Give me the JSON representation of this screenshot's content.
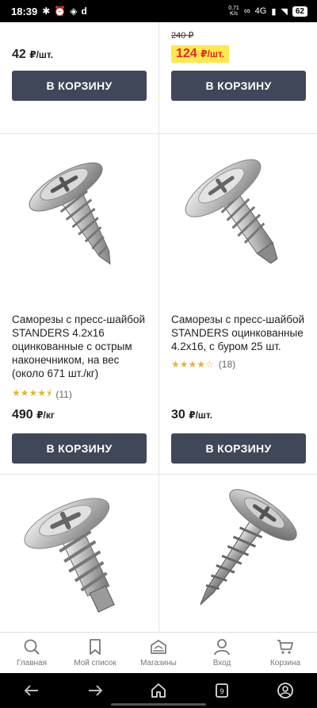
{
  "status_bar": {
    "time": "18:39",
    "net_speed": "0,71",
    "net_unit": "K/s",
    "signal": "4G",
    "battery": "62"
  },
  "products": [
    {
      "price_value": "42",
      "price_unit": "₽/шт.",
      "button_label": "В КОРЗИНУ"
    },
    {
      "old_price": "240 ₽",
      "price_value": "124",
      "price_unit": "₽/шт.",
      "button_label": "В КОРЗИНУ"
    },
    {
      "title": "Саморезы с пресс-шайбой STANDERS 4.2x16 оцинкованные с острым наконечником, на вес (около 671 шт./кг)",
      "rating_stars": 4.5,
      "reviews": "(11)",
      "price_value": "490",
      "price_unit": "₽/кг",
      "button_label": "В КОРЗИНУ",
      "image_icon": "screw-sharp-tip-icon"
    },
    {
      "title": "Саморезы с пресс-шайбой STANDERS оцинкованные 4.2x16, с буром 25 шт.",
      "rating_stars": 4,
      "reviews": "(18)",
      "price_value": "30",
      "price_unit": "₽/шт.",
      "button_label": "В КОРЗИНУ",
      "image_icon": "screw-drill-tip-icon"
    },
    {
      "image_icon": "screw-drill-tip-icon"
    },
    {
      "image_icon": "screw-sharp-tip-icon"
    }
  ],
  "bottom_nav": [
    {
      "label": "Главная",
      "icon": "search-icon"
    },
    {
      "label": "Мой список",
      "icon": "bookmark-icon"
    },
    {
      "label": "Магазины",
      "icon": "store-icon"
    },
    {
      "label": "Вход",
      "icon": "user-icon"
    },
    {
      "label": "Корзина",
      "icon": "cart-icon"
    }
  ],
  "colors": {
    "button_bg": "#3f4758",
    "sale_bg": "#ffe84d",
    "sale_text": "#e4282b",
    "star": "#e3b23c"
  }
}
